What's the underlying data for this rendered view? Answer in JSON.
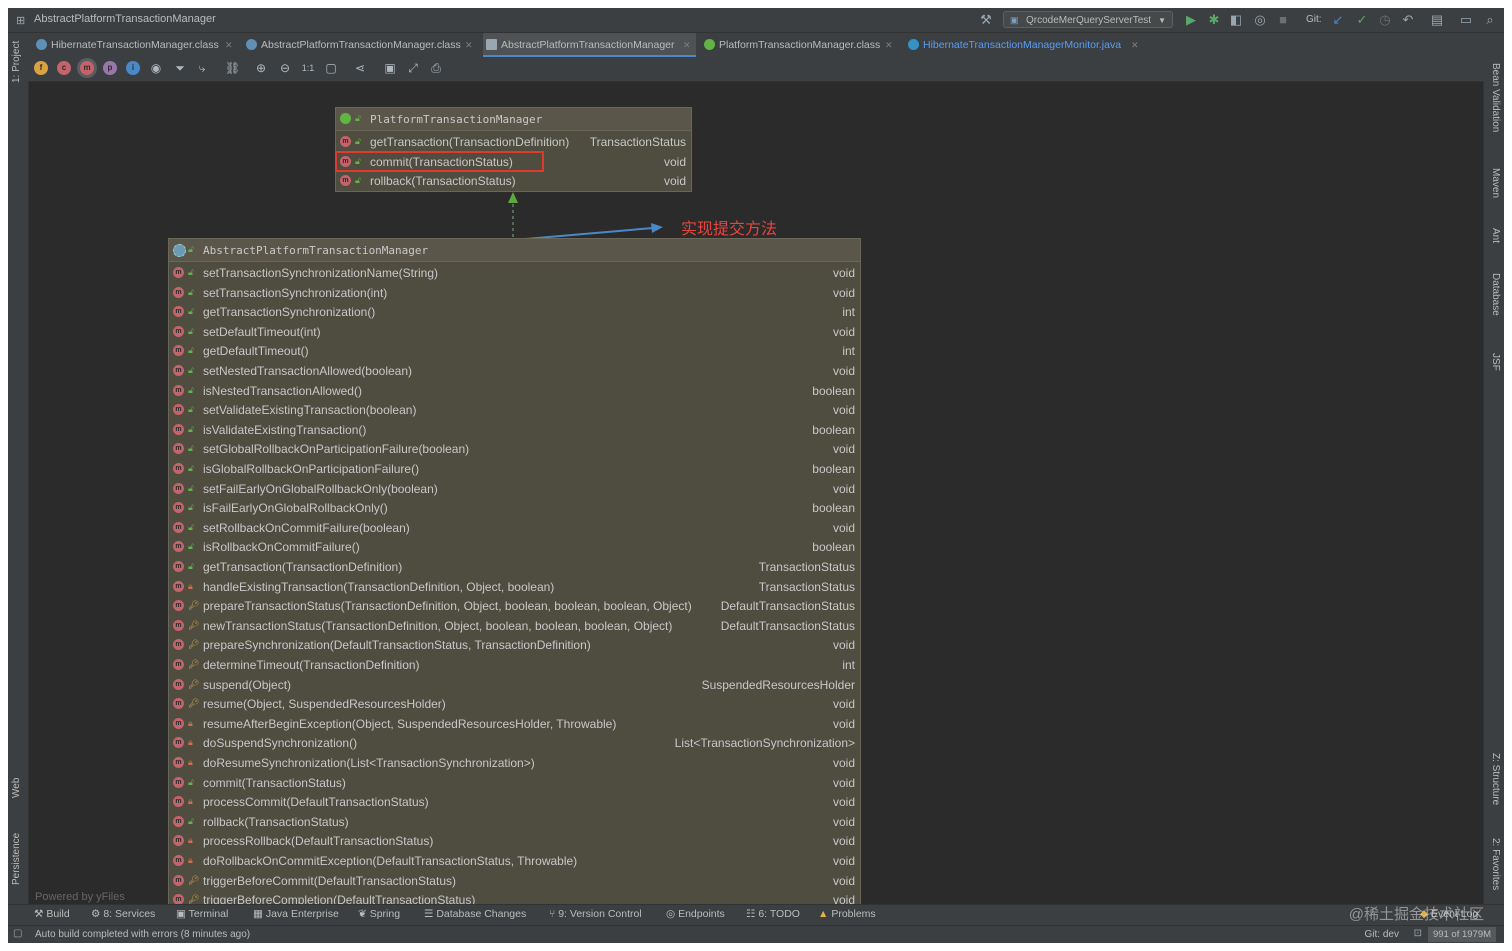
{
  "window": {
    "title": "AbstractPlatformTransactionManager"
  },
  "toolbar_top": {
    "run_config": "QrcodeMerQueryServerTest",
    "git_label": "Git:"
  },
  "tabs": [
    {
      "label": "HibernateTransactionManager.class",
      "icon_color": "#5f8fb4"
    },
    {
      "label": "AbstractPlatformTransactionManager.class",
      "icon_color": "#5f8fb4"
    },
    {
      "label": "AbstractPlatformTransactionManager",
      "icon_color": "#9aa7b0",
      "active": true
    },
    {
      "label": "PlatformTransactionManager.class",
      "icon_color": "#62b543"
    },
    {
      "label": "HibernateTransactionManagerMonitor.java",
      "icon_color": "#3592c4"
    }
  ],
  "left_strip": {
    "project": "1: Project",
    "web": "Web",
    "persistence": "Persistence"
  },
  "right_strip": {
    "bean_validation": "Bean Validation",
    "maven": "Maven",
    "ant": "Ant",
    "database": "Database",
    "jsf": "JSF",
    "structure": "Z: Structure",
    "favorites": "2: Favorites"
  },
  "diagram": {
    "interface_node": {
      "name": "PlatformTransactionManager",
      "methods": [
        {
          "name": "getTransaction(TransactionDefinition)",
          "type": "TransactionStatus"
        },
        {
          "name": "commit(TransactionStatus)",
          "type": "void"
        },
        {
          "name": "rollback(TransactionStatus)",
          "type": "void"
        }
      ]
    },
    "annotation": "实现提交方法",
    "class_node": {
      "name": "AbstractPlatformTransactionManager",
      "methods": [
        {
          "name": "setTransactionSynchronizationName(String)",
          "type": "void",
          "vis": "public"
        },
        {
          "name": "setTransactionSynchronization(int)",
          "type": "void",
          "vis": "public"
        },
        {
          "name": "getTransactionSynchronization()",
          "type": "int",
          "vis": "public"
        },
        {
          "name": "setDefaultTimeout(int)",
          "type": "void",
          "vis": "public"
        },
        {
          "name": "getDefaultTimeout()",
          "type": "int",
          "vis": "public"
        },
        {
          "name": "setNestedTransactionAllowed(boolean)",
          "type": "void",
          "vis": "public"
        },
        {
          "name": "isNestedTransactionAllowed()",
          "type": "boolean",
          "vis": "public"
        },
        {
          "name": "setValidateExistingTransaction(boolean)",
          "type": "void",
          "vis": "public"
        },
        {
          "name": "isValidateExistingTransaction()",
          "type": "boolean",
          "vis": "public"
        },
        {
          "name": "setGlobalRollbackOnParticipationFailure(boolean)",
          "type": "void",
          "vis": "public"
        },
        {
          "name": "isGlobalRollbackOnParticipationFailure()",
          "type": "boolean",
          "vis": "public"
        },
        {
          "name": "setFailEarlyOnGlobalRollbackOnly(boolean)",
          "type": "void",
          "vis": "public"
        },
        {
          "name": "isFailEarlyOnGlobalRollbackOnly()",
          "type": "boolean",
          "vis": "public"
        },
        {
          "name": "setRollbackOnCommitFailure(boolean)",
          "type": "void",
          "vis": "public"
        },
        {
          "name": "isRollbackOnCommitFailure()",
          "type": "boolean",
          "vis": "public"
        },
        {
          "name": "getTransaction(TransactionDefinition)",
          "type": "TransactionStatus",
          "vis": "public"
        },
        {
          "name": "handleExistingTransaction(TransactionDefinition, Object, boolean)",
          "type": "TransactionStatus",
          "vis": "private"
        },
        {
          "name": "prepareTransactionStatus(TransactionDefinition, Object, boolean, boolean, boolean, Object)",
          "type": "DefaultTransactionStatus",
          "vis": "protected"
        },
        {
          "name": "newTransactionStatus(TransactionDefinition, Object, boolean, boolean, boolean, Object)",
          "type": "DefaultTransactionStatus",
          "vis": "protected"
        },
        {
          "name": "prepareSynchronization(DefaultTransactionStatus, TransactionDefinition)",
          "type": "void",
          "vis": "protected"
        },
        {
          "name": "determineTimeout(TransactionDefinition)",
          "type": "int",
          "vis": "protected"
        },
        {
          "name": "suspend(Object)",
          "type": "SuspendedResourcesHolder",
          "vis": "protected"
        },
        {
          "name": "resume(Object, SuspendedResourcesHolder)",
          "type": "void",
          "vis": "protected"
        },
        {
          "name": "resumeAfterBeginException(Object, SuspendedResourcesHolder, Throwable)",
          "type": "void",
          "vis": "private"
        },
        {
          "name": "doSuspendSynchronization()",
          "type": "List<TransactionSynchronization>",
          "vis": "private"
        },
        {
          "name": "doResumeSynchronization(List<TransactionSynchronization>)",
          "type": "void",
          "vis": "private"
        },
        {
          "name": "commit(TransactionStatus)",
          "type": "void",
          "vis": "public"
        },
        {
          "name": "processCommit(DefaultTransactionStatus)",
          "type": "void",
          "vis": "private"
        },
        {
          "name": "rollback(TransactionStatus)",
          "type": "void",
          "vis": "public"
        },
        {
          "name": "processRollback(DefaultTransactionStatus)",
          "type": "void",
          "vis": "private"
        },
        {
          "name": "doRollbackOnCommitException(DefaultTransactionStatus, Throwable)",
          "type": "void",
          "vis": "private"
        },
        {
          "name": "triggerBeforeCommit(DefaultTransactionStatus)",
          "type": "void",
          "vis": "protected"
        },
        {
          "name": "triggerBeforeCompletion(DefaultTransactionStatus)",
          "type": "void",
          "vis": "protected"
        }
      ]
    },
    "powered_by": "Powered by yFiles"
  },
  "bottom_tabs": [
    {
      "label": "Build",
      "icon": "hammer-icon"
    },
    {
      "label": "8: Services",
      "icon": "services-icon"
    },
    {
      "label": "Terminal",
      "icon": "terminal-icon"
    },
    {
      "label": "Java Enterprise",
      "icon": "java-enterprise-icon"
    },
    {
      "label": "Spring",
      "icon": "spring-icon"
    },
    {
      "label": "Database Changes",
      "icon": "database-changes-icon"
    },
    {
      "label": "9: Version Control",
      "icon": "version-control-icon"
    },
    {
      "label": "Endpoints",
      "icon": "endpoints-icon"
    },
    {
      "label": "6: TODO",
      "icon": "todo-icon"
    },
    {
      "label": "Problems",
      "icon": "warning-icon"
    }
  ],
  "status": {
    "message": "Auto build completed with errors (8 minutes ago)",
    "git_branch": "Git: dev",
    "memory": "991 of 1979M",
    "event_log": "Event Log"
  },
  "watermark": "@稀土掘金技术社区",
  "colors": {
    "method_icon": "#c3636b",
    "public": "#62b543",
    "private": "#d0704a",
    "protected": "#c9a14a",
    "highlight": "#e03a2f",
    "annotation": "#e8453c",
    "arrow": "#4a88c7",
    "inherit_arrow": "#5faa3c"
  }
}
